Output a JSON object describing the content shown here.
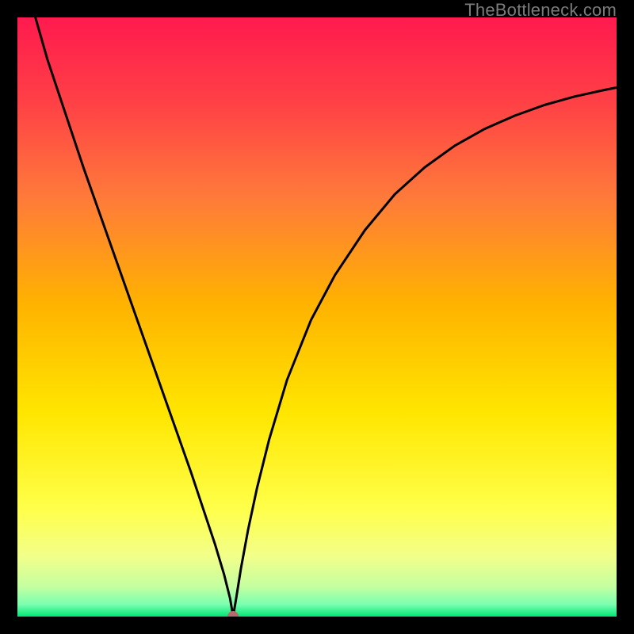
{
  "watermark": "TheBottleneck.com",
  "chart_data": {
    "type": "line",
    "title": "",
    "xlabel": "",
    "ylabel": "",
    "xlim": [
      0,
      100
    ],
    "ylim": [
      0,
      100
    ],
    "grid": false,
    "legend": false,
    "background_gradient": {
      "top_color": "#ff1a4e",
      "mid_colors": [
        "#ff6e3a",
        "#ffb300",
        "#ffe600",
        "#f5ff5e"
      ],
      "bottom_color": "#00e676"
    },
    "minimum_marker": {
      "x": 36,
      "y": 0,
      "color": "#b86a6a",
      "radius_px": 7
    },
    "series": [
      {
        "name": "bottleneck-curve",
        "color": "#000000",
        "x": [
          3,
          5,
          8,
          11,
          14,
          17,
          20,
          23,
          26,
          29,
          31,
          33,
          34.5,
          35.5,
          36,
          36.5,
          37.3,
          38.5,
          40,
          42,
          45,
          49,
          53,
          58,
          63,
          68,
          73,
          78,
          83,
          88,
          93,
          98,
          100
        ],
        "y": [
          100,
          93,
          84,
          75,
          66.5,
          58,
          49.5,
          41,
          32.5,
          24,
          18,
          12,
          7,
          3,
          0,
          3,
          8,
          14.5,
          21.5,
          29.5,
          39.5,
          49.5,
          57,
          64.5,
          70.5,
          75,
          78.6,
          81.4,
          83.6,
          85.4,
          86.8,
          87.9,
          88.3
        ]
      }
    ]
  }
}
